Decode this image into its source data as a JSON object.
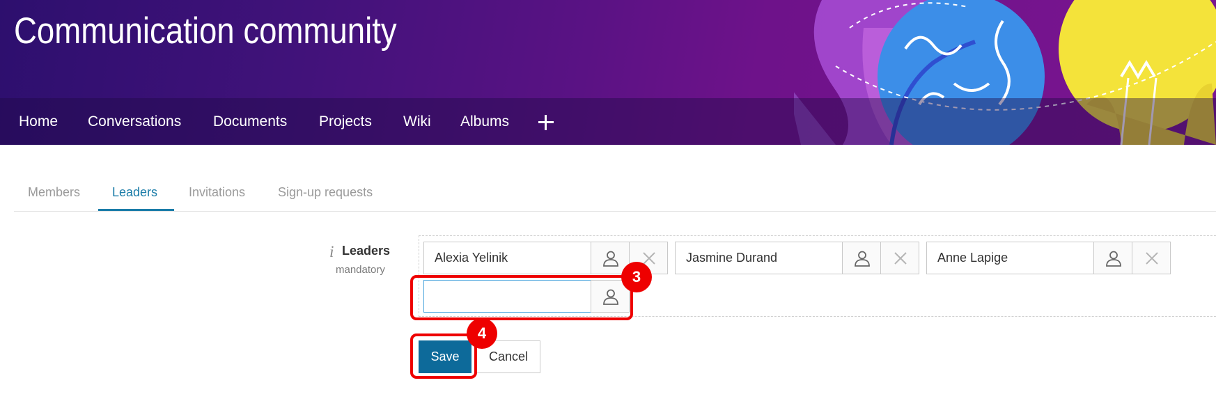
{
  "header": {
    "community_title": "Communication community",
    "nav_items": [
      "Home",
      "Conversations",
      "Documents",
      "Projects",
      "Wiki",
      "Albums"
    ]
  },
  "tabs": [
    {
      "label": "Members",
      "active": false
    },
    {
      "label": "Leaders",
      "active": true
    },
    {
      "label": "Invitations",
      "active": false
    },
    {
      "label": "Sign-up requests",
      "active": false
    }
  ],
  "form": {
    "field_label": "Leaders",
    "field_sublabel": "mandatory",
    "leaders": [
      "Alexia Yelinik",
      "Jasmine Durand",
      "Anne Lapige"
    ],
    "new_leader_value": "",
    "save_label": "Save",
    "cancel_label": "Cancel"
  },
  "annotations": {
    "step_input": "3",
    "step_save": "4",
    "highlight_color": "#ee0000"
  },
  "colors": {
    "accent": "#1a7ca8",
    "save_button": "#0d6a9a",
    "banner": "#4a127c"
  }
}
